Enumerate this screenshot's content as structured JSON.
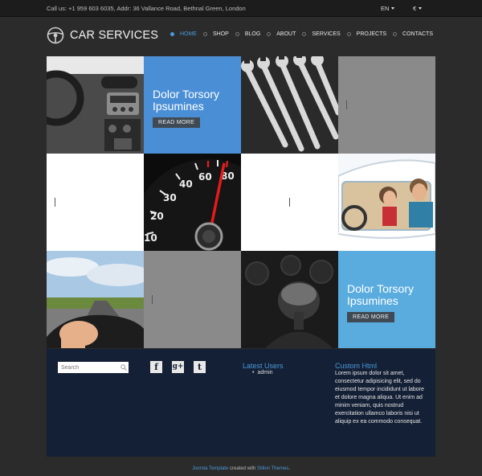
{
  "topbar": {
    "contact": "Call us: +1 959 603 6035, Addr: 36 Vallance Road, Bethnal Green, London",
    "language": "EN",
    "currency": "€"
  },
  "brand": {
    "name": "CAR SERVICES"
  },
  "nav": {
    "items": [
      {
        "label": "HOME",
        "active": true
      },
      {
        "label": "SHOP"
      },
      {
        "label": "BLOG"
      },
      {
        "label": "ABOUT"
      },
      {
        "label": "SERVICES"
      },
      {
        "label": "PROJECTS"
      },
      {
        "label": "CONTACTS"
      }
    ]
  },
  "promos": [
    {
      "title": "Dolor Torsory Ipsumines",
      "button": "READ MORE",
      "color": "#4a8fd6"
    },
    {
      "title": "Dolor Torsory Ipsumines",
      "button": "READ MORE",
      "color": "#5aacdf"
    }
  ],
  "footer": {
    "search_placeholder": "Search",
    "latest_users_title": "Latest Users",
    "latest_users": [
      "admin"
    ],
    "custom_html_title": "Custom Html",
    "custom_html_text": "Lorem ipsum dolor sit amet, consectetur adipisicing elit, sed do eiusmod tempor incididunt ut labore et dolore magna aliqua. Ut enim ad minim veniam, quis nostrud exercitation ullamco laboris nisi ut aliquip ex ea commodo consequat."
  },
  "credit": {
    "link1": "Joomla Template",
    "middle": " created with ",
    "link2": "Sillion Themes",
    "end": "."
  },
  "colors": {
    "accent": "#4a9ad9",
    "footer_bg": "#142035",
    "gray_tile": "#8a8a8a"
  }
}
